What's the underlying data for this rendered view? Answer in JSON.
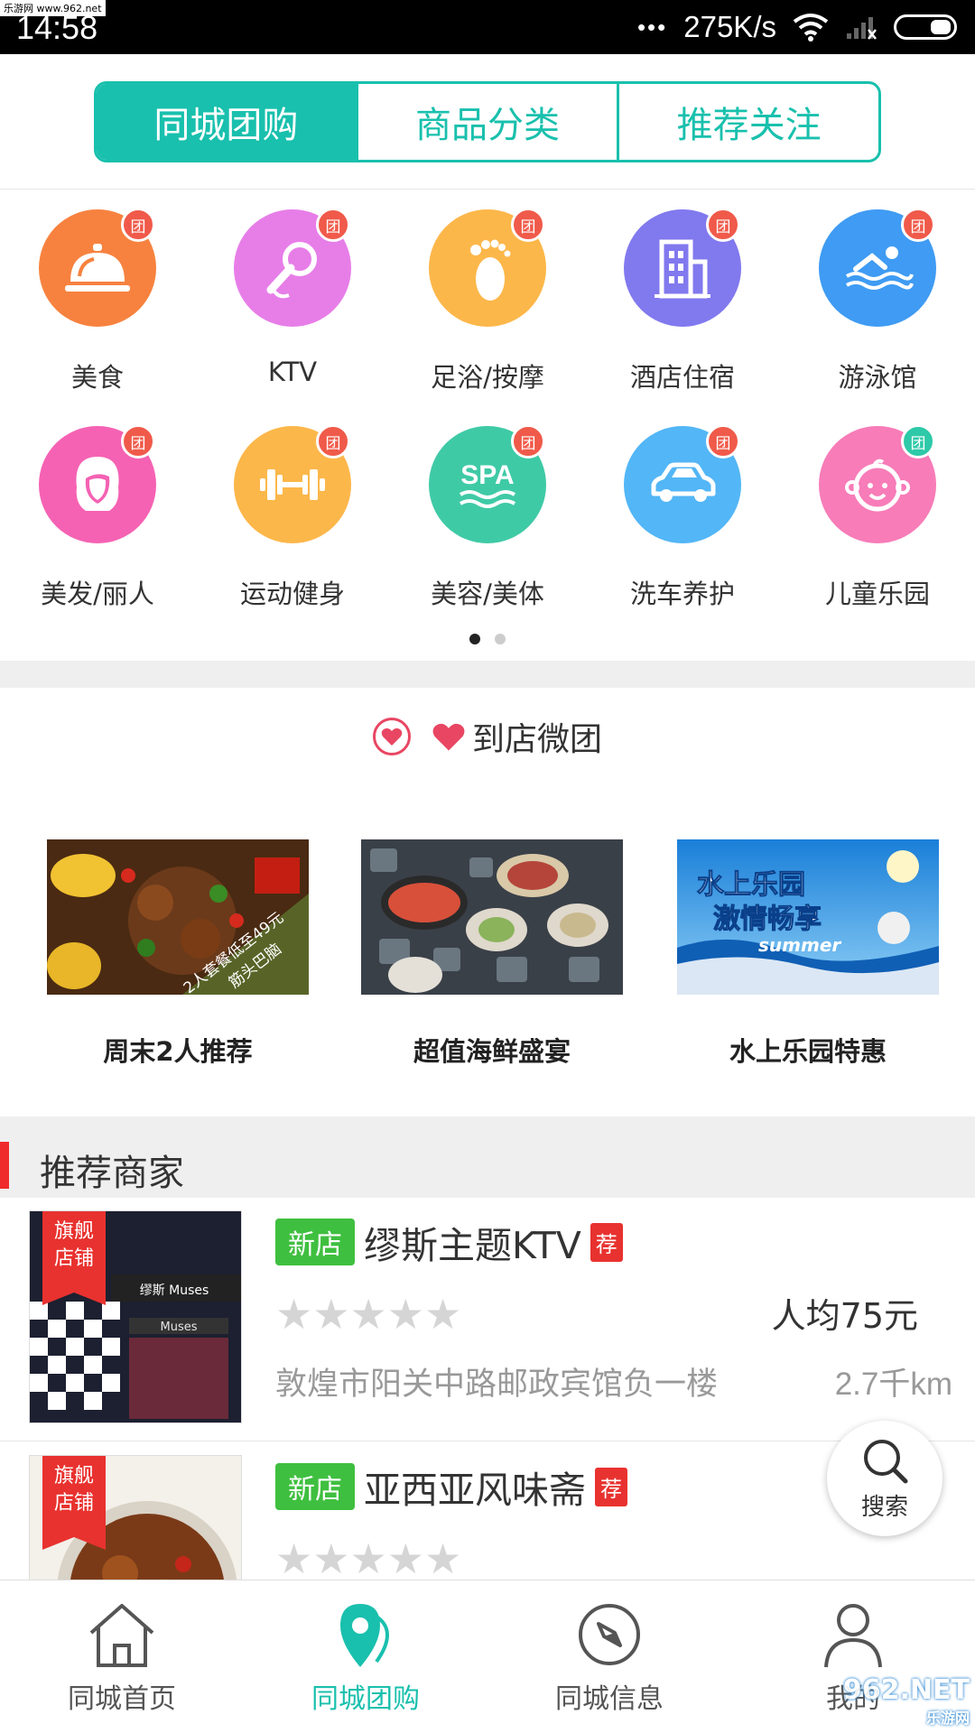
{
  "watermark_top": "乐游网 www.962.net",
  "status_bar": {
    "time": "14:58",
    "dots": "•••",
    "network_speed": "275K/s"
  },
  "tabs": [
    {
      "label": "同城团购",
      "active": true
    },
    {
      "label": "商品分类",
      "active": false
    },
    {
      "label": "推荐关注",
      "active": false
    }
  ],
  "categories": [
    {
      "label": "美食",
      "icon": "food-cloche-icon",
      "color": "#f7823f",
      "badge": "团"
    },
    {
      "label": "KTV",
      "icon": "microphone-icon",
      "color": "#e77ee8",
      "badge": "团"
    },
    {
      "label": "足浴/按摩",
      "icon": "foot-icon",
      "color": "#fcb74a",
      "badge": "团"
    },
    {
      "label": "酒店住宿",
      "icon": "hotel-building-icon",
      "color": "#8179ee",
      "badge": "团"
    },
    {
      "label": "游泳馆",
      "icon": "swimmer-icon",
      "color": "#3f9bf3",
      "badge": "团"
    },
    {
      "label": "美发/丽人",
      "icon": "woman-hair-icon",
      "color": "#f562b3",
      "badge": "团"
    },
    {
      "label": "运动健身",
      "icon": "dumbbell-icon",
      "color": "#fcb74a",
      "badge": "团"
    },
    {
      "label": "美容/美体",
      "icon": "spa-icon",
      "color": "#3fcaa6",
      "badge": "团"
    },
    {
      "label": "洗车养护",
      "icon": "car-icon",
      "color": "#53b6f6",
      "badge": "团"
    },
    {
      "label": "儿童乐园",
      "icon": "baby-face-icon",
      "color": "#f77cb8",
      "badge": "团"
    }
  ],
  "micro_group": {
    "title": "到店微团",
    "promos": [
      {
        "caption": "周末2人推荐",
        "overlay_line1": "2人套餐低至49元",
        "overlay_line2": "筋头巴脑"
      },
      {
        "caption": "超值海鲜盛宴"
      },
      {
        "caption": "水上乐园特惠",
        "overlay_line1": "水上乐园",
        "overlay_line2": "激情畅享",
        "overlay_line3": "summer"
      }
    ]
  },
  "recommend": {
    "title": "推荐商家",
    "merchants": [
      {
        "flag_line1": "旗舰",
        "flag_line2": "店铺",
        "tag_new": "新店",
        "name": "缪斯主题KTV",
        "tag_rec": "荐",
        "stars": "★★★★★",
        "price": "人均75元",
        "address": "敦煌市阳关中路邮政宾馆负一楼",
        "distance": "2.7千km",
        "thumb_sign": "缪斯 Muses",
        "thumb_sign2": "Muses"
      },
      {
        "flag_line1": "旗舰",
        "flag_line2": "店铺",
        "tag_new": "新店",
        "name": "亚西亚风味斋",
        "tag_rec": "荐",
        "stars": "★★★★★"
      }
    ]
  },
  "fab": {
    "label": "搜索"
  },
  "bottom_nav": [
    {
      "label": "同城首页",
      "icon": "home-icon",
      "active": false
    },
    {
      "label": "同城团购",
      "icon": "location-pin-icon",
      "active": true
    },
    {
      "label": "同城信息",
      "icon": "compass-icon",
      "active": false
    },
    {
      "label": "我的",
      "icon": "user-icon",
      "active": false
    }
  ],
  "watermark_bottom": {
    "main": "962.NET",
    "sub": "乐游网"
  },
  "colors": {
    "accent": "#19c0ad",
    "red": "#e8322f",
    "green_tag": "#3fbf3f"
  }
}
